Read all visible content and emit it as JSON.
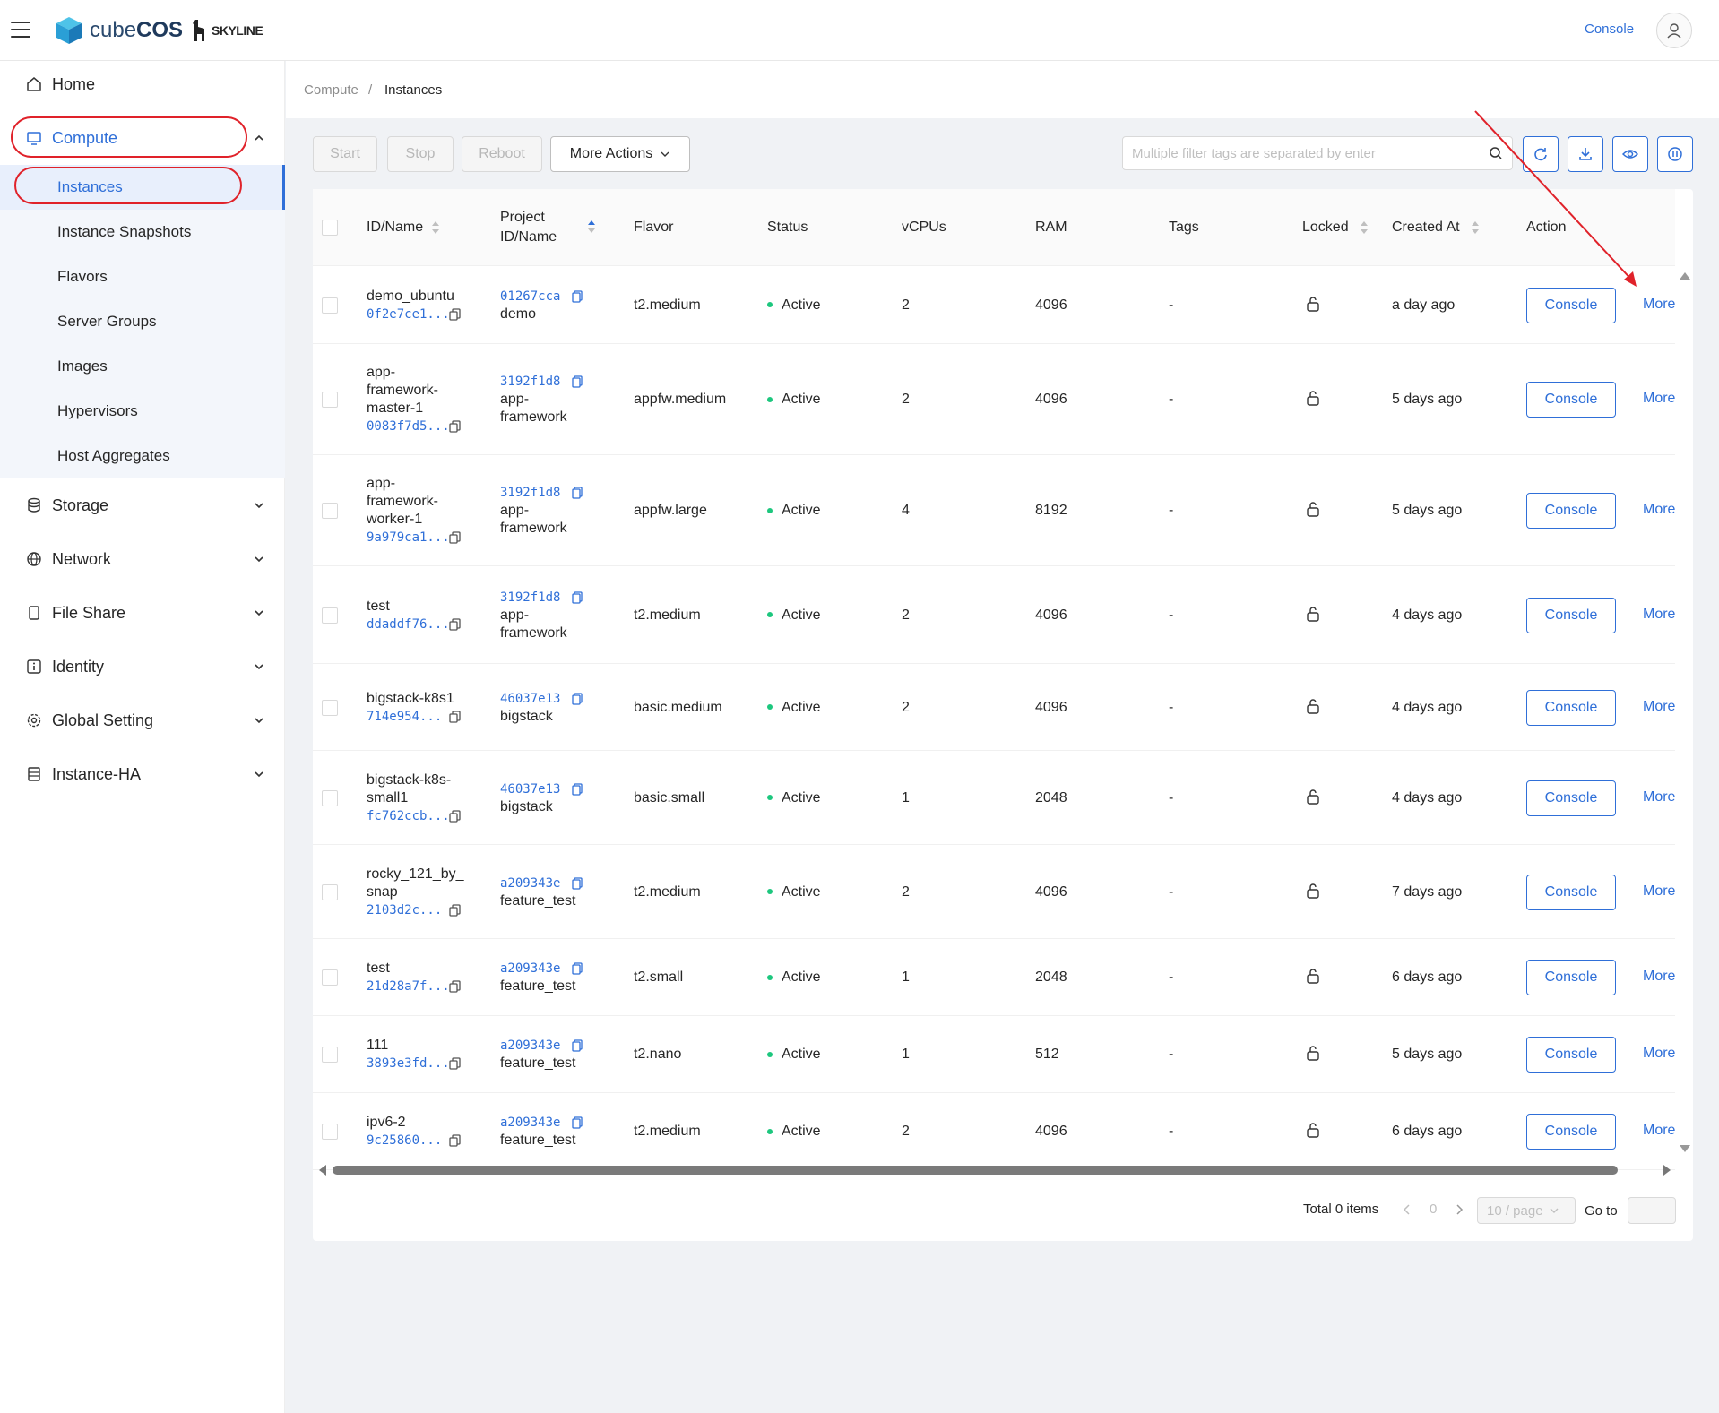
{
  "header": {
    "brand": "cubeCOS",
    "brand_light": "cube",
    "brand_bold": "COS",
    "partner": "SKYLINE",
    "console_link": "Console"
  },
  "sidebar": {
    "items": [
      {
        "label": "Home",
        "icon": "home-icon"
      },
      {
        "label": "Compute",
        "icon": "monitor-icon"
      },
      {
        "label": "Storage",
        "icon": "database-icon"
      },
      {
        "label": "Network",
        "icon": "globe-icon"
      },
      {
        "label": "File Share",
        "icon": "file-icon"
      },
      {
        "label": "Identity",
        "icon": "info-icon"
      },
      {
        "label": "Global Setting",
        "icon": "gear-icon"
      },
      {
        "label": "Instance-HA",
        "icon": "server-icon"
      }
    ],
    "compute_sub": [
      {
        "label": "Instances",
        "active": true
      },
      {
        "label": "Instance Snapshots"
      },
      {
        "label": "Flavors"
      },
      {
        "label": "Server Groups"
      },
      {
        "label": "Images"
      },
      {
        "label": "Hypervisors"
      },
      {
        "label": "Host Aggregates"
      }
    ]
  },
  "breadcrumb": {
    "parent": "Compute",
    "separator": "/",
    "current": "Instances"
  },
  "toolbar": {
    "start": "Start",
    "stop": "Stop",
    "reboot": "Reboot",
    "more_actions": "More Actions",
    "search_placeholder": "Multiple filter tags are separated by enter"
  },
  "table": {
    "headers": {
      "id_name": "ID/Name",
      "project": "Project ID/Name",
      "project_l1": "Project",
      "project_l2": "ID/Name",
      "flavor": "Flavor",
      "status": "Status",
      "vcpus": "vCPUs",
      "ram": "RAM",
      "tags": "Tags",
      "locked": "Locked",
      "created": "Created At",
      "action": "Action"
    },
    "console_label": "Console",
    "more_label": "More",
    "rows": [
      {
        "name_lines": [
          "demo_ubuntu"
        ],
        "id": "0f2e7ce1...",
        "project_id": "01267cca",
        "project_lines": [
          "demo"
        ],
        "flavor": "t2.medium",
        "status": "Active",
        "vcpus": "2",
        "ram": "4096",
        "tags": "-",
        "created": "a day ago"
      },
      {
        "name_lines": [
          "app-",
          "framework-",
          "master-1"
        ],
        "id": "0083f7d5...",
        "project_id": "3192f1d8",
        "project_lines": [
          "app-",
          "framework"
        ],
        "flavor": "appfw.medium",
        "status": "Active",
        "vcpus": "2",
        "ram": "4096",
        "tags": "-",
        "created": "5 days ago"
      },
      {
        "name_lines": [
          "app-",
          "framework-",
          "worker-1"
        ],
        "id": "9a979ca1...",
        "project_id": "3192f1d8",
        "project_lines": [
          "app-",
          "framework"
        ],
        "flavor": "appfw.large",
        "status": "Active",
        "vcpus": "4",
        "ram": "8192",
        "tags": "-",
        "created": "5 days ago"
      },
      {
        "name_lines": [
          "test"
        ],
        "id": "ddaddf76...",
        "project_id": "3192f1d8",
        "project_lines": [
          "app-",
          "framework"
        ],
        "flavor": "t2.medium",
        "status": "Active",
        "vcpus": "2",
        "ram": "4096",
        "tags": "-",
        "created": "4 days ago"
      },
      {
        "name_lines": [
          "bigstack-k8s1"
        ],
        "id": "714e954...",
        "project_id": "46037e13",
        "project_lines": [
          "bigstack"
        ],
        "flavor": "basic.medium",
        "status": "Active",
        "vcpus": "2",
        "ram": "4096",
        "tags": "-",
        "created": "4 days ago"
      },
      {
        "name_lines": [
          "bigstack-k8s-",
          "small1"
        ],
        "id": "fc762ccb...",
        "project_id": "46037e13",
        "project_lines": [
          "bigstack"
        ],
        "flavor": "basic.small",
        "status": "Active",
        "vcpus": "1",
        "ram": "2048",
        "tags": "-",
        "created": "4 days ago"
      },
      {
        "name_lines": [
          "rocky_121_by_",
          "snap"
        ],
        "id": "2103d2c...",
        "project_id": "a209343e",
        "project_lines": [
          "feature_test"
        ],
        "flavor": "t2.medium",
        "status": "Active",
        "vcpus": "2",
        "ram": "4096",
        "tags": "-",
        "created": "7 days ago"
      },
      {
        "name_lines": [
          "test"
        ],
        "id": "21d28a7f...",
        "project_id": "a209343e",
        "project_lines": [
          "feature_test"
        ],
        "flavor": "t2.small",
        "status": "Active",
        "vcpus": "1",
        "ram": "2048",
        "tags": "-",
        "created": "6 days ago"
      },
      {
        "name_lines": [
          "111"
        ],
        "id": "3893e3fd...",
        "project_id": "a209343e",
        "project_lines": [
          "feature_test"
        ],
        "flavor": "t2.nano",
        "status": "Active",
        "vcpus": "1",
        "ram": "512",
        "tags": "-",
        "created": "5 days ago"
      },
      {
        "name_lines": [
          "ipv6-2"
        ],
        "id": "9c25860...",
        "project_id": "a209343e",
        "project_lines": [
          "feature_test"
        ],
        "flavor": "t2.medium",
        "status": "Active",
        "vcpus": "2",
        "ram": "4096",
        "tags": "-",
        "created": "6 days ago"
      }
    ]
  },
  "pagination": {
    "total": "Total 0 items",
    "current_page": "0",
    "page_size": "10 / page",
    "goto": "Go to"
  },
  "colors": {
    "accent": "#2f6fd8",
    "active": "#1dc77e",
    "annotation": "#e0222a"
  }
}
